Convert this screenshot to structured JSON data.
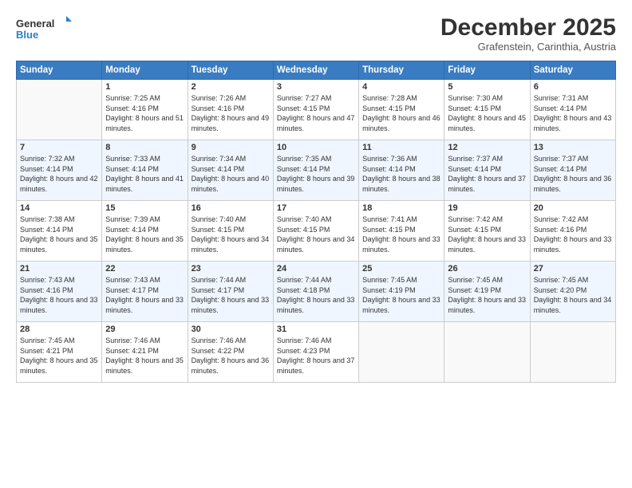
{
  "logo": {
    "line1": "General",
    "line2": "Blue",
    "icon_color": "#2e7ec7"
  },
  "title": "December 2025",
  "subtitle": "Grafenstein, Carinthia, Austria",
  "header_days": [
    "Sunday",
    "Monday",
    "Tuesday",
    "Wednesday",
    "Thursday",
    "Friday",
    "Saturday"
  ],
  "weeks": [
    [
      {
        "day": "",
        "sunrise": "",
        "sunset": "",
        "daylight": ""
      },
      {
        "day": "1",
        "sunrise": "Sunrise: 7:25 AM",
        "sunset": "Sunset: 4:16 PM",
        "daylight": "Daylight: 8 hours and 51 minutes."
      },
      {
        "day": "2",
        "sunrise": "Sunrise: 7:26 AM",
        "sunset": "Sunset: 4:16 PM",
        "daylight": "Daylight: 8 hours and 49 minutes."
      },
      {
        "day": "3",
        "sunrise": "Sunrise: 7:27 AM",
        "sunset": "Sunset: 4:15 PM",
        "daylight": "Daylight: 8 hours and 47 minutes."
      },
      {
        "day": "4",
        "sunrise": "Sunrise: 7:28 AM",
        "sunset": "Sunset: 4:15 PM",
        "daylight": "Daylight: 8 hours and 46 minutes."
      },
      {
        "day": "5",
        "sunrise": "Sunrise: 7:30 AM",
        "sunset": "Sunset: 4:15 PM",
        "daylight": "Daylight: 8 hours and 45 minutes."
      },
      {
        "day": "6",
        "sunrise": "Sunrise: 7:31 AM",
        "sunset": "Sunset: 4:14 PM",
        "daylight": "Daylight: 8 hours and 43 minutes."
      }
    ],
    [
      {
        "day": "7",
        "sunrise": "Sunrise: 7:32 AM",
        "sunset": "Sunset: 4:14 PM",
        "daylight": "Daylight: 8 hours and 42 minutes."
      },
      {
        "day": "8",
        "sunrise": "Sunrise: 7:33 AM",
        "sunset": "Sunset: 4:14 PM",
        "daylight": "Daylight: 8 hours and 41 minutes."
      },
      {
        "day": "9",
        "sunrise": "Sunrise: 7:34 AM",
        "sunset": "Sunset: 4:14 PM",
        "daylight": "Daylight: 8 hours and 40 minutes."
      },
      {
        "day": "10",
        "sunrise": "Sunrise: 7:35 AM",
        "sunset": "Sunset: 4:14 PM",
        "daylight": "Daylight: 8 hours and 39 minutes."
      },
      {
        "day": "11",
        "sunrise": "Sunrise: 7:36 AM",
        "sunset": "Sunset: 4:14 PM",
        "daylight": "Daylight: 8 hours and 38 minutes."
      },
      {
        "day": "12",
        "sunrise": "Sunrise: 7:37 AM",
        "sunset": "Sunset: 4:14 PM",
        "daylight": "Daylight: 8 hours and 37 minutes."
      },
      {
        "day": "13",
        "sunrise": "Sunrise: 7:37 AM",
        "sunset": "Sunset: 4:14 PM",
        "daylight": "Daylight: 8 hours and 36 minutes."
      }
    ],
    [
      {
        "day": "14",
        "sunrise": "Sunrise: 7:38 AM",
        "sunset": "Sunset: 4:14 PM",
        "daylight": "Daylight: 8 hours and 35 minutes."
      },
      {
        "day": "15",
        "sunrise": "Sunrise: 7:39 AM",
        "sunset": "Sunset: 4:14 PM",
        "daylight": "Daylight: 8 hours and 35 minutes."
      },
      {
        "day": "16",
        "sunrise": "Sunrise: 7:40 AM",
        "sunset": "Sunset: 4:15 PM",
        "daylight": "Daylight: 8 hours and 34 minutes."
      },
      {
        "day": "17",
        "sunrise": "Sunrise: 7:40 AM",
        "sunset": "Sunset: 4:15 PM",
        "daylight": "Daylight: 8 hours and 34 minutes."
      },
      {
        "day": "18",
        "sunrise": "Sunrise: 7:41 AM",
        "sunset": "Sunset: 4:15 PM",
        "daylight": "Daylight: 8 hours and 33 minutes."
      },
      {
        "day": "19",
        "sunrise": "Sunrise: 7:42 AM",
        "sunset": "Sunset: 4:15 PM",
        "daylight": "Daylight: 8 hours and 33 minutes."
      },
      {
        "day": "20",
        "sunrise": "Sunrise: 7:42 AM",
        "sunset": "Sunset: 4:16 PM",
        "daylight": "Daylight: 8 hours and 33 minutes."
      }
    ],
    [
      {
        "day": "21",
        "sunrise": "Sunrise: 7:43 AM",
        "sunset": "Sunset: 4:16 PM",
        "daylight": "Daylight: 8 hours and 33 minutes."
      },
      {
        "day": "22",
        "sunrise": "Sunrise: 7:43 AM",
        "sunset": "Sunset: 4:17 PM",
        "daylight": "Daylight: 8 hours and 33 minutes."
      },
      {
        "day": "23",
        "sunrise": "Sunrise: 7:44 AM",
        "sunset": "Sunset: 4:17 PM",
        "daylight": "Daylight: 8 hours and 33 minutes."
      },
      {
        "day": "24",
        "sunrise": "Sunrise: 7:44 AM",
        "sunset": "Sunset: 4:18 PM",
        "daylight": "Daylight: 8 hours and 33 minutes."
      },
      {
        "day": "25",
        "sunrise": "Sunrise: 7:45 AM",
        "sunset": "Sunset: 4:19 PM",
        "daylight": "Daylight: 8 hours and 33 minutes."
      },
      {
        "day": "26",
        "sunrise": "Sunrise: 7:45 AM",
        "sunset": "Sunset: 4:19 PM",
        "daylight": "Daylight: 8 hours and 33 minutes."
      },
      {
        "day": "27",
        "sunrise": "Sunrise: 7:45 AM",
        "sunset": "Sunset: 4:20 PM",
        "daylight": "Daylight: 8 hours and 34 minutes."
      }
    ],
    [
      {
        "day": "28",
        "sunrise": "Sunrise: 7:45 AM",
        "sunset": "Sunset: 4:21 PM",
        "daylight": "Daylight: 8 hours and 35 minutes."
      },
      {
        "day": "29",
        "sunrise": "Sunrise: 7:46 AM",
        "sunset": "Sunset: 4:21 PM",
        "daylight": "Daylight: 8 hours and 35 minutes."
      },
      {
        "day": "30",
        "sunrise": "Sunrise: 7:46 AM",
        "sunset": "Sunset: 4:22 PM",
        "daylight": "Daylight: 8 hours and 36 minutes."
      },
      {
        "day": "31",
        "sunrise": "Sunrise: 7:46 AM",
        "sunset": "Sunset: 4:23 PM",
        "daylight": "Daylight: 8 hours and 37 minutes."
      },
      {
        "day": "",
        "sunrise": "",
        "sunset": "",
        "daylight": ""
      },
      {
        "day": "",
        "sunrise": "",
        "sunset": "",
        "daylight": ""
      },
      {
        "day": "",
        "sunrise": "",
        "sunset": "",
        "daylight": ""
      }
    ]
  ]
}
